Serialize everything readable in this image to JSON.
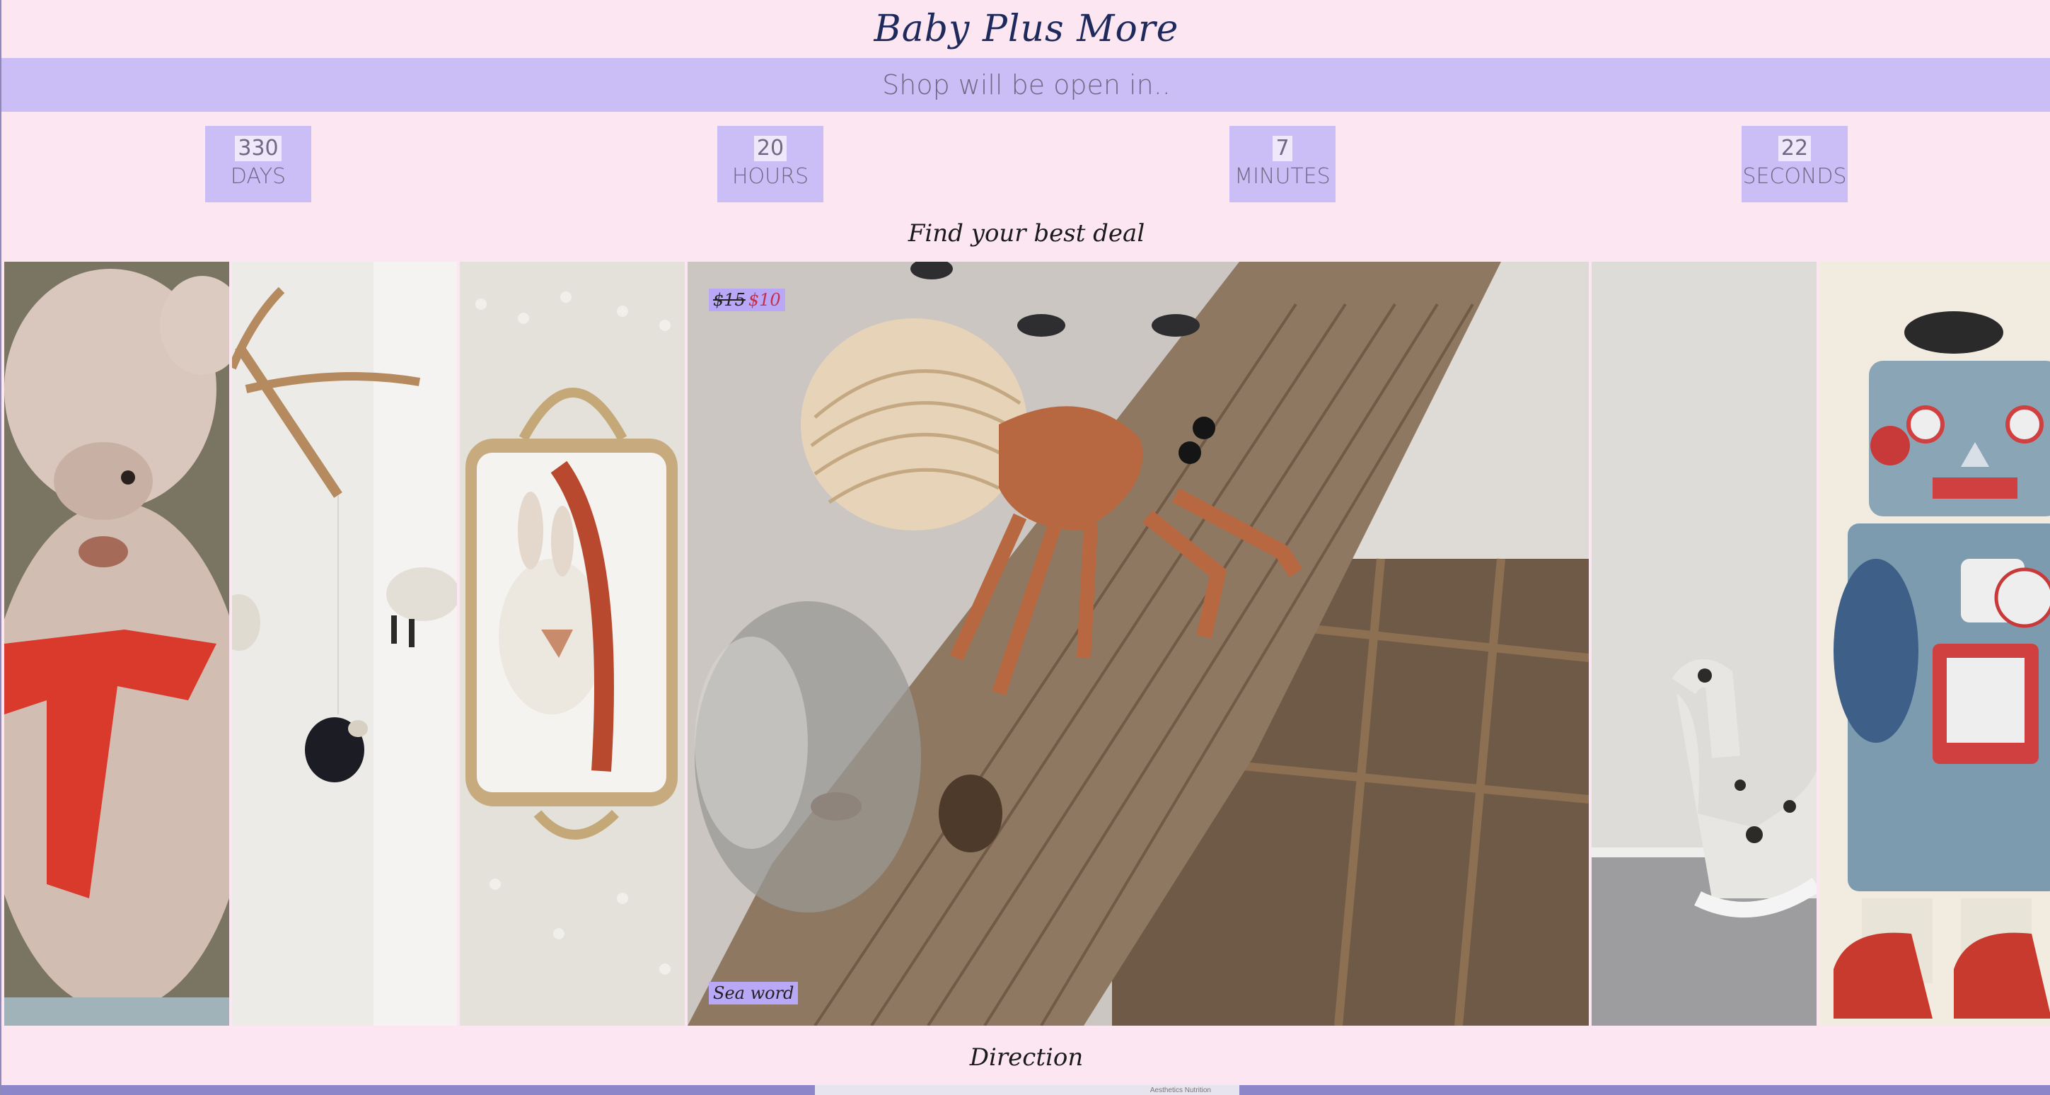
{
  "header": {
    "brand": "Baby Plus More"
  },
  "banner": {
    "text": "Shop will be open in.."
  },
  "countdown": [
    {
      "value": "330",
      "unit": "DAYS"
    },
    {
      "value": "20",
      "unit": "HOURS"
    },
    {
      "value": "7",
      "unit": "MINUTES"
    },
    {
      "value": "22",
      "unit": "SECONDS"
    }
  ],
  "deal": {
    "heading": "Find your best deal"
  },
  "gallery": {
    "featured": {
      "old_price": "$15",
      "new_price": "$10",
      "name": "Sea word"
    }
  },
  "direction": {
    "heading": "Direction"
  },
  "map": {
    "label": "Aesthetics Nutrition"
  },
  "colors": {
    "background": "#fce6f1",
    "accent": "#cbbdf6",
    "brand_text": "#1f2a5c"
  }
}
